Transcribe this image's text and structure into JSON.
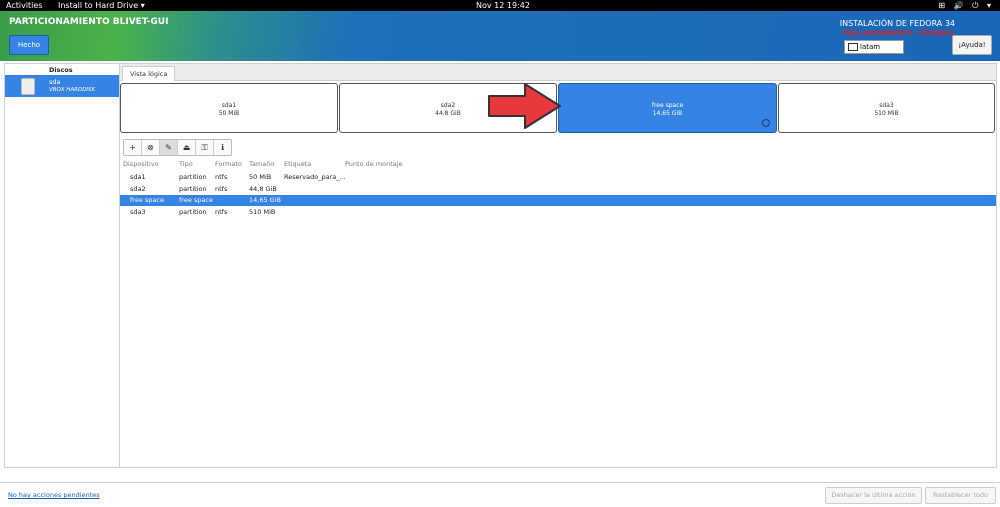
{
  "topbar": {
    "activities": "Activities",
    "app_name": "Install to Hard Drive ▾",
    "clock": "Nov 12  19:42",
    "tray": "⊞ 🔊 ⏻ ▾"
  },
  "header": {
    "title": "PARTICIONAMIENTO BLIVET-GUI",
    "done_label": "Hecho",
    "install_title": "INSTALACIÓN DE FEDORA 34",
    "prerelease": "PRE-LANZAMIENTO / PRUEBAS",
    "keyboard": "latam",
    "help_label": "¡Ayuda!"
  },
  "sidebar": {
    "heading": "Discos",
    "disks": [
      {
        "name": "sda",
        "model": "VBOX HARDDISK"
      }
    ]
  },
  "main": {
    "tab_label": "Vista lógica",
    "partitions": [
      {
        "name": "sda1",
        "size": "50 MiB",
        "selected": false
      },
      {
        "name": "sda2",
        "size": "44,8 GiB",
        "selected": false
      },
      {
        "name": "free space",
        "size": "14,65 GiB",
        "selected": true
      },
      {
        "name": "sda3",
        "size": "510 MiB",
        "selected": false
      }
    ],
    "toolbar": [
      {
        "name": "add-icon",
        "glyph": "+"
      },
      {
        "name": "delete-icon",
        "glyph": "⊗"
      },
      {
        "name": "edit-icon",
        "glyph": "✎"
      },
      {
        "name": "unmount-icon",
        "glyph": "⏏"
      },
      {
        "name": "key-icon",
        "glyph": "⚿"
      },
      {
        "name": "info-icon",
        "glyph": "ℹ"
      }
    ],
    "columns": [
      "Dispositivo",
      "Tipo",
      "Formato",
      "Tamaño",
      "Etiqueta",
      "Punto de montaje"
    ],
    "rows": [
      {
        "device": "sda1",
        "type": "partition",
        "format": "ntfs",
        "size": "50 MiB",
        "label": "Reservado_para_...",
        "mount": ""
      },
      {
        "device": "sda2",
        "type": "partition",
        "format": "ntfs",
        "size": "44,8 GiB",
        "label": "",
        "mount": ""
      },
      {
        "device": "free space",
        "type": "free space",
        "format": "",
        "size": "14,65 GiB",
        "label": "",
        "mount": ""
      },
      {
        "device": "sda3",
        "type": "partition",
        "format": "ntfs",
        "size": "510 MiB",
        "label": "",
        "mount": ""
      }
    ],
    "selected_row": 2
  },
  "status": {
    "pending": "No hay acciones pendientes",
    "undo_label": "Deshacer la última acción",
    "reset_label": "Restablecer todo"
  },
  "colors": {
    "accent": "#3584e4",
    "arrow": "#e8383d"
  }
}
